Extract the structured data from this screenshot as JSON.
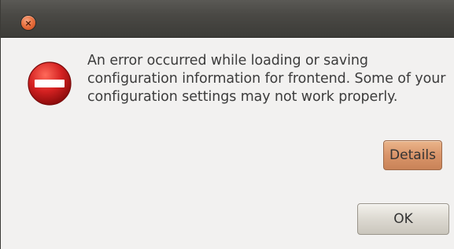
{
  "titlebar": {
    "close_glyph": "×"
  },
  "dialog": {
    "icon": "error-icon",
    "message": "An error occurred while loading or saving configuration information for frontend. Some of your configuration settings may not work properly.",
    "buttons": {
      "details_label": "Details",
      "ok_label": "OK"
    }
  },
  "colors": {
    "titlebar": "#3c3b37",
    "close_button": "#e9713f",
    "error_icon": "#d42121",
    "details_button": "#d9946a",
    "background": "#f2f1f0"
  }
}
